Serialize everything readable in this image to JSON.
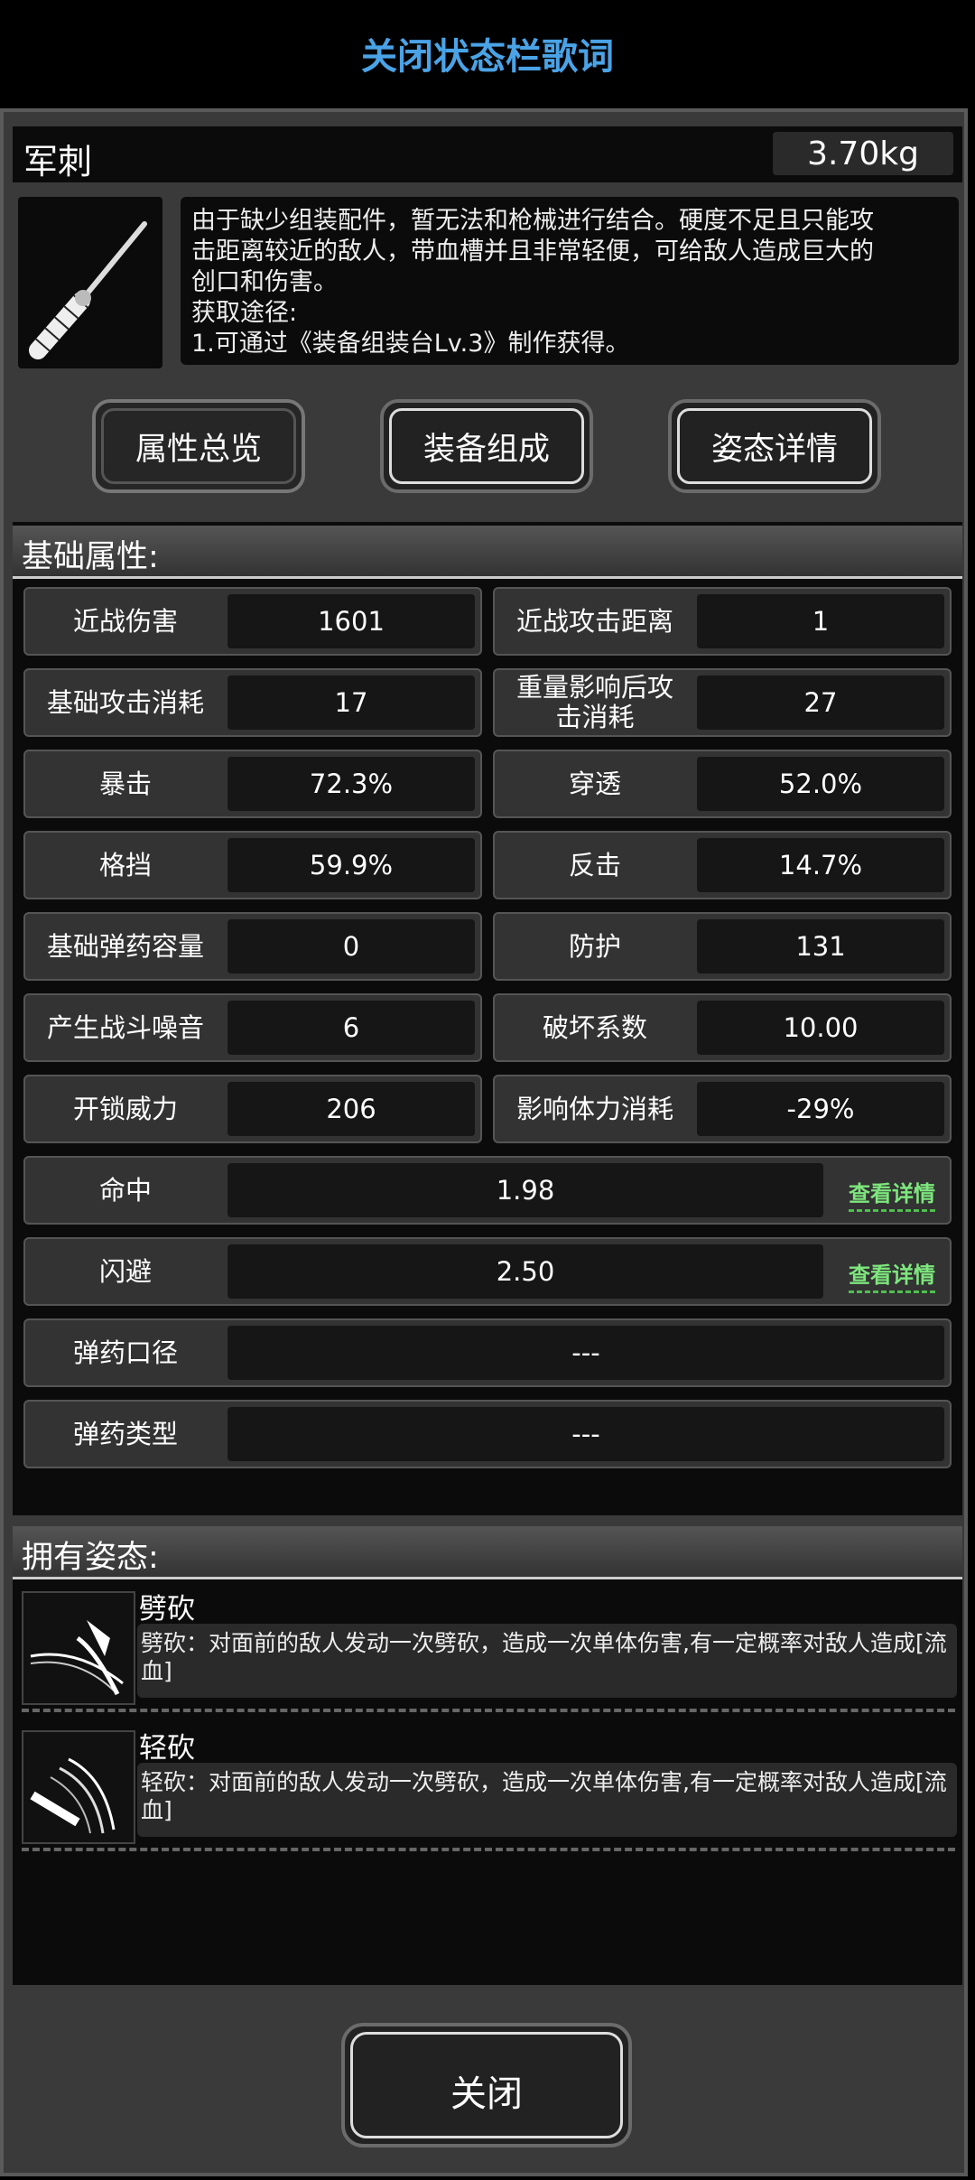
{
  "status_bar": {
    "title": "关闭状态栏歌词"
  },
  "item": {
    "name": "军刺",
    "weight": "3.70kg",
    "icon": "bayonet-knife-icon",
    "description_lines": [
      "由于缺少组装配件，暂无法和枪械进行结合。硬度不足且只能攻",
      "击距离较近的敌人，带血槽并且非常轻便，可给敌人造成巨大的",
      "创口和伤害。",
      "获取途径:",
      "1.可通过《装备组装台Lv.3》制作获得。"
    ]
  },
  "tabs": [
    {
      "label": "属性总览",
      "active": true
    },
    {
      "label": "装备组成",
      "active": false
    },
    {
      "label": "姿态详情",
      "active": false
    }
  ],
  "stats": {
    "section_title": "基础属性:",
    "grid": [
      {
        "label": "近战伤害",
        "value": "1601"
      },
      {
        "label": "近战攻击距离",
        "value": "1"
      },
      {
        "label": "基础攻击消耗",
        "value": "17"
      },
      {
        "label": "重量影响后攻击消耗",
        "value": "27"
      },
      {
        "label": "暴击",
        "value": "72.3%"
      },
      {
        "label": "穿透",
        "value": "52.0%"
      },
      {
        "label": "格挡",
        "value": "59.9%"
      },
      {
        "label": "反击",
        "value": "14.7%"
      },
      {
        "label": "基础弹药容量",
        "value": "0"
      },
      {
        "label": "防护",
        "value": "131"
      },
      {
        "label": "产生战斗噪音",
        "value": "6"
      },
      {
        "label": "破坏系数",
        "value": "10.00"
      },
      {
        "label": "开锁威力",
        "value": "206"
      },
      {
        "label": "影响体力消耗",
        "value": "-29%"
      }
    ],
    "wide": [
      {
        "label": "命中",
        "value": "1.98",
        "link": "查看详情"
      },
      {
        "label": "闪避",
        "value": "2.50",
        "link": "查看详情"
      },
      {
        "label": "弹药口径",
        "value": "---"
      },
      {
        "label": "弹药类型",
        "value": "---"
      }
    ]
  },
  "stances": {
    "section_title": "拥有姿态:",
    "items": [
      {
        "name": "劈砍",
        "icon": "slash-icon",
        "desc": "劈砍：对面前的敌人发动一次劈砍，造成一次单体伤害,有一定概率对敌人造成[流血]"
      },
      {
        "name": "轻砍",
        "icon": "light-slash-icon",
        "desc": "轻砍：对面前的敌人发动一次劈砍，造成一次单体伤害,有一定概率对敌人造成[流血]"
      }
    ]
  },
  "close_label": "关闭"
}
